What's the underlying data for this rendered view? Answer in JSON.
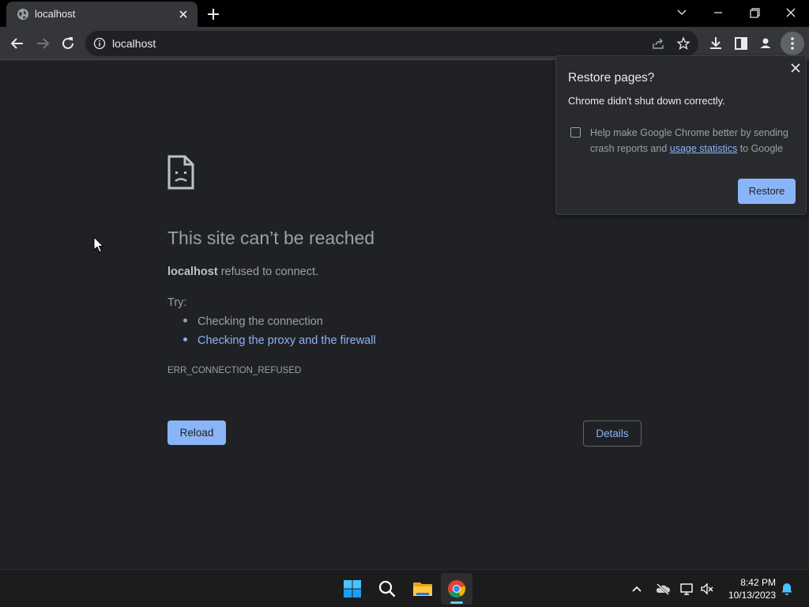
{
  "browser": {
    "tab": {
      "title": "localhost"
    },
    "address_bar": {
      "url": "localhost"
    }
  },
  "error_page": {
    "title": "This site can’t be reached",
    "host": "localhost",
    "message": "refused to connect.",
    "try_label": "Try:",
    "suggestions": [
      {
        "text": "Checking the connection"
      },
      {
        "text": "Checking the proxy and the firewall"
      }
    ],
    "error_code": "ERR_CONNECTION_REFUSED",
    "reload_label": "Reload",
    "details_label": "Details"
  },
  "restore_popup": {
    "title": "Restore pages?",
    "message": "Chrome didn't shut down correctly.",
    "checkbox_text_before": "Help make Google Chrome better by sending crash reports and ",
    "checkbox_link": "usage statistics",
    "checkbox_text_after": " to Google",
    "restore_label": "Restore"
  },
  "taskbar": {
    "time": "8:42 PM",
    "date": "10/13/2023"
  },
  "colors": {
    "accent": "#8ab4f8",
    "background": "#202124",
    "taskbar": "#1c1c1c"
  }
}
